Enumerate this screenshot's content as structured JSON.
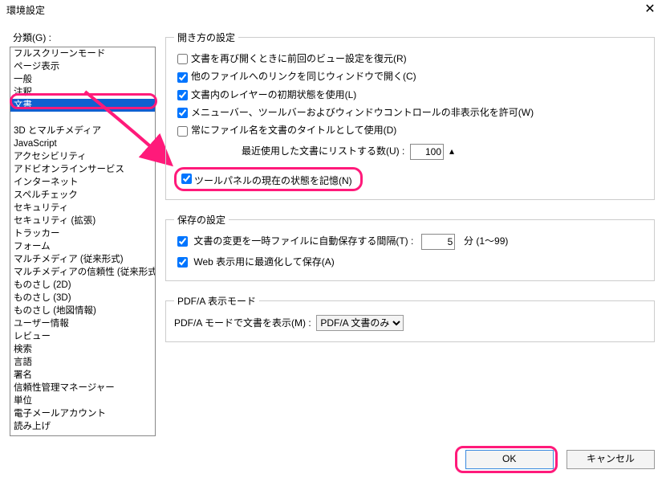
{
  "window_title": "環境設定",
  "close_glyph": "✕",
  "category_label": "分類(G) :",
  "categories": [
    "フルスクリーンモード",
    "ページ表示",
    "一般",
    "注釈",
    "文書",
    "",
    "3D とマルチメディア",
    "JavaScript",
    "アクセシビリティ",
    "アドビオンラインサービス",
    "インターネット",
    "スペルチェック",
    "セキュリティ",
    "セキュリティ (拡張)",
    "トラッカー",
    "フォーム",
    "マルチメディア (従来形式)",
    "マルチメディアの信頼性 (従来形式)",
    "ものさし (2D)",
    "ものさし (3D)",
    "ものさし (地図情報)",
    "ユーザー情報",
    "レビュー",
    "検索",
    "言語",
    "署名",
    "信頼性管理マネージャー",
    "単位",
    "電子メールアカウント",
    "読み上げ"
  ],
  "selected_category": "文書",
  "open": {
    "legend": "開き方の設定",
    "restore_view": "文書を再び開くときに前回のビュー設定を復元(R)",
    "same_window": "他のファイルへのリンクを同じウィンドウで開く(C)",
    "layer_state": "文書内のレイヤーの初期状態を使用(L)",
    "allow_hide": "メニューバー、ツールバーおよびウィンドウコントロールの非表示化を許可(W)",
    "file_title": "常にファイル名を文書のタイトルとして使用(D)",
    "recent_label": "最近使用した文書にリストする数(U) :",
    "recent_value": "100",
    "tool_panel": "ツールパネルの現在の状態を記憶(N)"
  },
  "save": {
    "legend": "保存の設定",
    "autosave_label": "文書の変更を一時ファイルに自動保存する間隔(T) :",
    "autosave_value": "5",
    "autosave_unit": "分 (1〜99)",
    "optimize_web": "Web 表示用に最適化して保存(A)"
  },
  "pdfa": {
    "legend": "PDF/A 表示モード",
    "label": "PDF/A モードで文書を表示(M) :",
    "value": "PDF/A 文書のみ"
  },
  "buttons": {
    "ok": "OK",
    "cancel": "キャンセル"
  }
}
